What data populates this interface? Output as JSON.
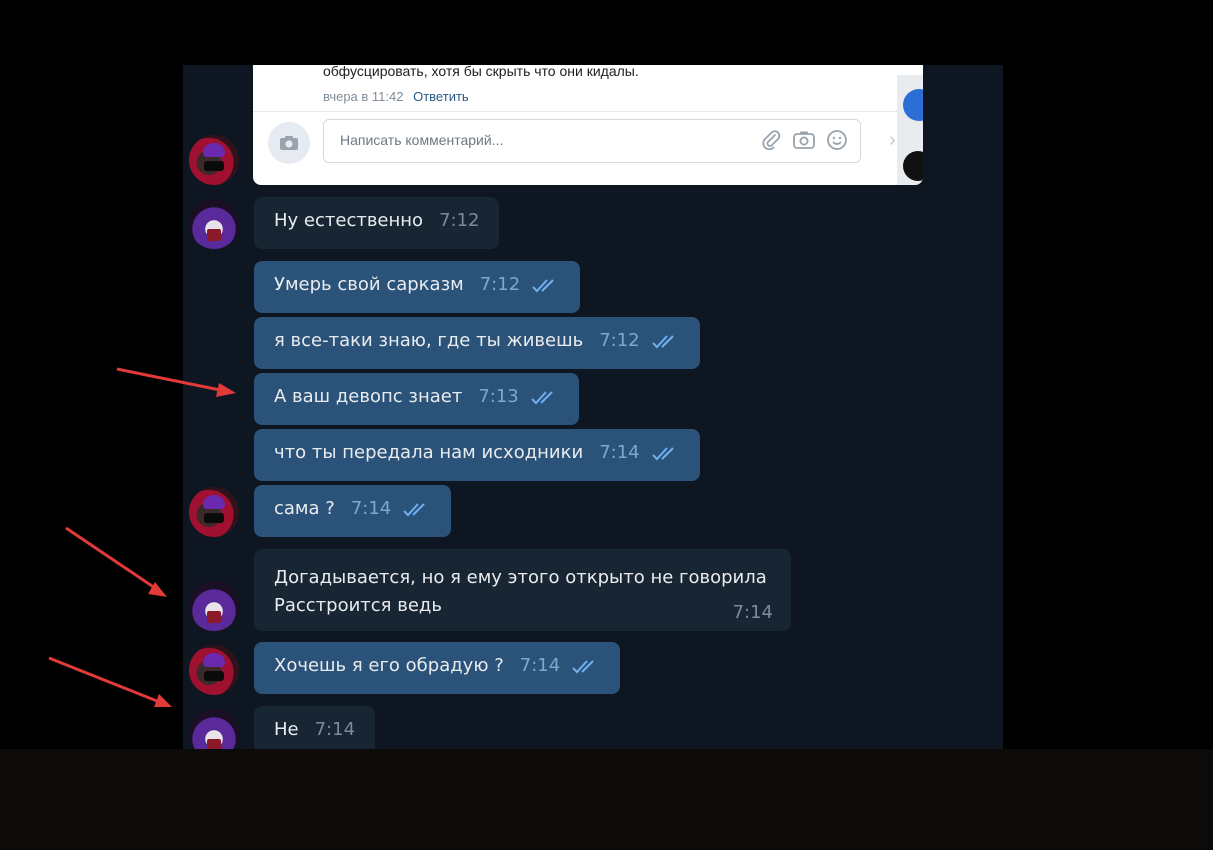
{
  "vk_post": {
    "comment_text": "обфусцировать, хотя бы скрыть что они кидалы.",
    "comment_date": "вчера в 11:42",
    "reply_link": "Ответить",
    "comment_placeholder": "Написать комментарий...",
    "icons": [
      "camera-icon",
      "paperclip-icon",
      "photo-icon",
      "smile-icon"
    ]
  },
  "messages": [
    {
      "text": "Ну естественно",
      "time": "7:12",
      "direction": "in"
    },
    {
      "text": "Умерь свой сарказм",
      "time": "7:12",
      "direction": "out",
      "read": true
    },
    {
      "text": "я все-таки знаю, где ты живешь",
      "time": "7:12",
      "direction": "out",
      "read": true
    },
    {
      "text": "А ваш девопс знает",
      "time": "7:13",
      "direction": "out",
      "read": true
    },
    {
      "text": "что ты передала нам исходники",
      "time": "7:14",
      "direction": "out",
      "read": true
    },
    {
      "text": "сама ?",
      "time": "7:14",
      "direction": "out",
      "read": true
    },
    {
      "lines": [
        "Догадывается, но я ему этого открыто не говорила",
        "Расстроится ведь"
      ],
      "time": "7:14",
      "direction": "in"
    },
    {
      "text": "Хочешь я его обрадую ?",
      "time": "7:14",
      "direction": "out",
      "read": true
    },
    {
      "text": "Не",
      "time": "7:14",
      "direction": "in"
    }
  ],
  "colors": {
    "outgoing_bubble": "#2b5278",
    "incoming_bubble": "#182533",
    "chat_background": "#0e1621",
    "annotation_arrow": "#e03a3a",
    "read_ticks": "#6fb0f0"
  }
}
